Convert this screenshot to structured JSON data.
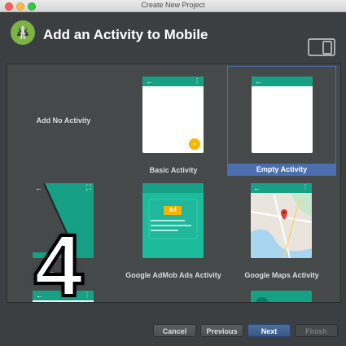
{
  "window": {
    "title": "Create New Project"
  },
  "header": {
    "title": "Add an Activity to Mobile"
  },
  "colors": {
    "accent": "#16a085",
    "selection": "#4b6eaf",
    "fab": "#f4b400"
  },
  "tiles": [
    {
      "label": "Add No Activity"
    },
    {
      "label": "Basic Activity"
    },
    {
      "label": "Empty Activity"
    },
    {
      "label": "Fullscreen Activity",
      "visible_label": "F          ctivity"
    },
    {
      "label": "Google AdMob Ads Activity",
      "badge": "Ad"
    },
    {
      "label": "Google Maps Activity"
    }
  ],
  "icons": {
    "back": "←",
    "menu": "⋮",
    "fullscreen": "⛶",
    "fab": "+"
  },
  "buttons": {
    "cancel": "Cancel",
    "previous": "Previous",
    "next": "Next",
    "finish": "Finish"
  },
  "overlay": {
    "number": "4"
  }
}
